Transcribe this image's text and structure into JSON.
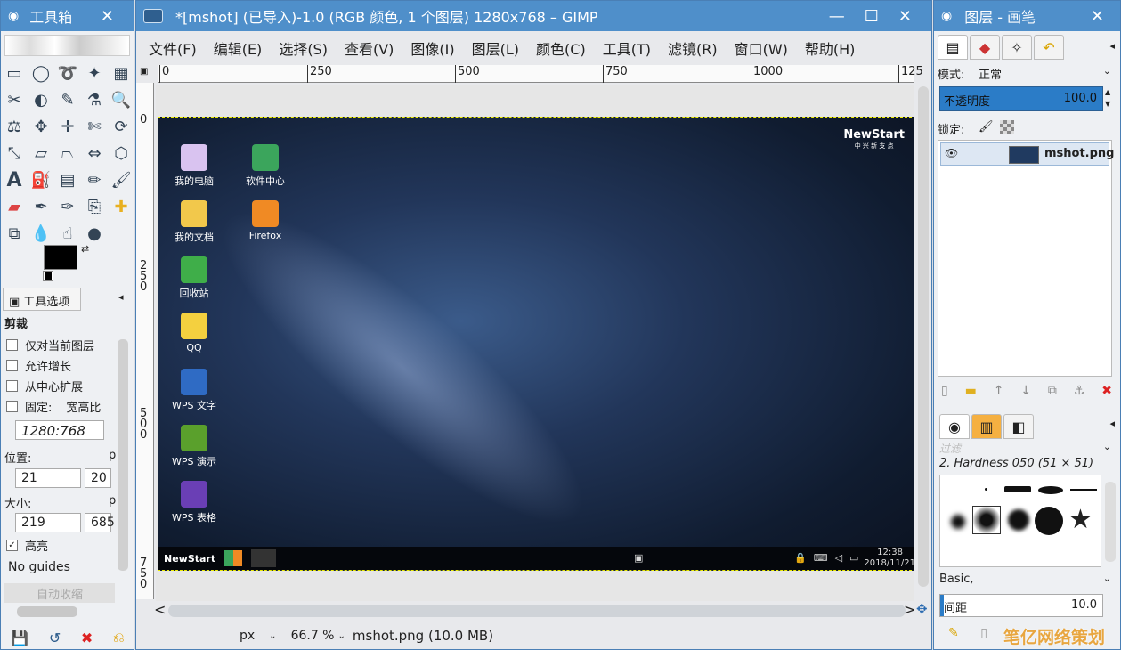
{
  "toolbox": {
    "title": "工具箱",
    "close": "✕",
    "tool_options_title": "工具选项",
    "tool_name": "剪裁",
    "options": [
      {
        "label": "仅对当前图层",
        "checked": false
      },
      {
        "label": "允许增长",
        "checked": false
      },
      {
        "label": "从中心扩展",
        "checked": false
      },
      {
        "label": "固定:",
        "checked": false,
        "extra": "宽高比"
      }
    ],
    "ratio_value": "1280:768",
    "position_label": "位置:",
    "pos_x": "21",
    "pos_y": "20",
    "size_label": "大小:",
    "size_w": "219",
    "size_h": "685",
    "highlight": {
      "label": "高亮",
      "checked": true
    },
    "guides": "No guides",
    "auto_shrink": "自动收缩",
    "unit_p": "p"
  },
  "main": {
    "title": "*[mshot] (已导入)-1.0 (RGB 颜色, 1 个图层) 1280x768 – GIMP",
    "menu": [
      "文件(F)",
      "编辑(E)",
      "选择(S)",
      "查看(V)",
      "图像(I)",
      "图层(L)",
      "颜色(C)",
      "工具(T)",
      "滤镜(R)",
      "窗口(W)",
      "帮助(H)"
    ],
    "ruler_h": [
      "0",
      "250",
      "500",
      "750",
      "1000",
      "125"
    ],
    "ruler_v": [
      "0",
      "2\n5\n0",
      "5\n0\n0",
      "7\n5\n0"
    ],
    "status": {
      "unit": "px",
      "zoom": "66.7 %",
      "file": "mshot.png (10.0 MB)"
    }
  },
  "desktop": {
    "icons": [
      {
        "label": "我的电脑",
        "color": "#d9c3f0"
      },
      {
        "label": "软件中心",
        "color": "#3ba55c"
      },
      {
        "label": "我的文档",
        "color": "#f2c84b"
      },
      {
        "label": "Firefox",
        "color": "#f08a24"
      },
      {
        "label": "回收站",
        "color": "#3fae49"
      },
      {
        "label": "QQ",
        "color": "#f4d03f"
      },
      {
        "label": "WPS 文字",
        "color": "#2f6bc4"
      },
      {
        "label": "WPS 演示",
        "color": "#5aa02c"
      },
      {
        "label": "WPS 表格",
        "color": "#6a3fb5"
      }
    ],
    "brand": "NewStart",
    "brand_sub": "中 兴 新 支 点",
    "taskbar_brand": "NewStart",
    "time": "12:38",
    "date": "2018/11/21"
  },
  "layers": {
    "title": "图层 - 画笔",
    "mode_label": "模式:",
    "mode_value": "正常",
    "opacity_label": "不透明度",
    "opacity_value": "100.0",
    "lock_label": "锁定:",
    "layer_name": "mshot.png",
    "filter_placeholder": "过滤",
    "brush_name": "2. Hardness 050 (51 × 51)",
    "brush_set": "Basic,",
    "spacing_label": "间距",
    "spacing_value": "10.0"
  },
  "watermark": "笔亿网络策划"
}
